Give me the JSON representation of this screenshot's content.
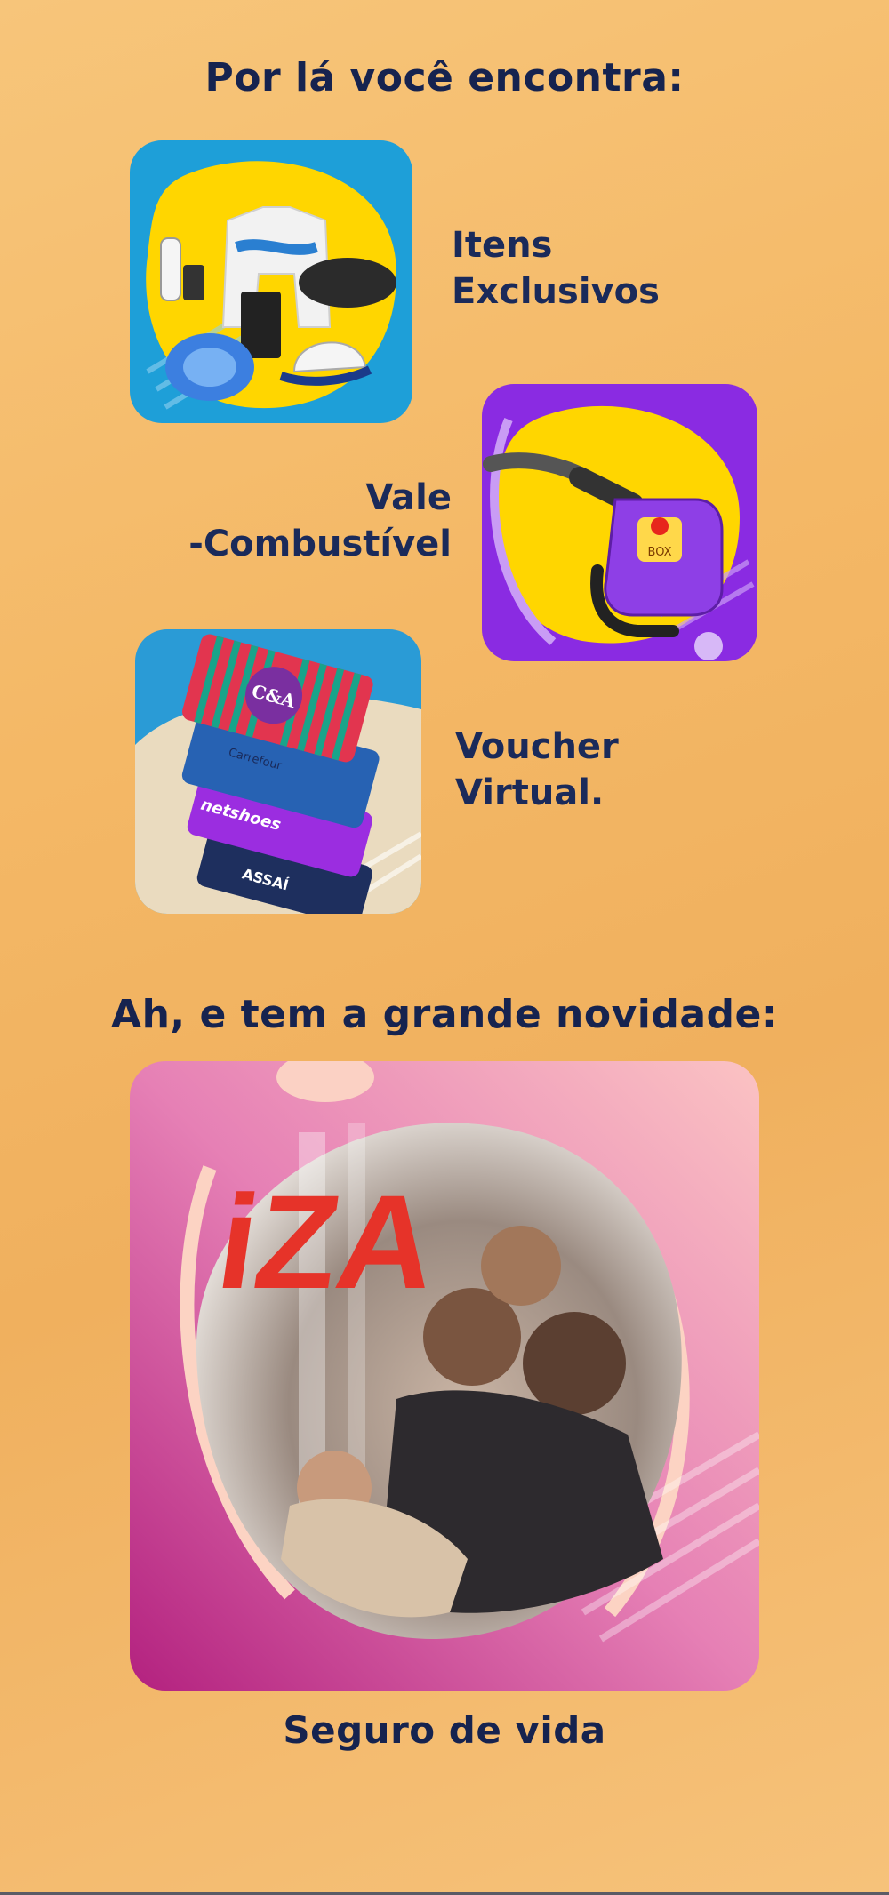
{
  "section_one": {
    "title": "Por lá você encontra:",
    "items": [
      {
        "label_line1": "Itens",
        "label_line2": "Exclusivos",
        "image": "exclusive-items-image"
      },
      {
        "label_line1": "Vale",
        "label_line2": "-Combustível",
        "image": "fuel-voucher-image"
      },
      {
        "label_line1": "Voucher",
        "label_line2": "Virtual.",
        "image": "virtual-voucher-image"
      }
    ]
  },
  "section_two": {
    "title": "Ah, e tem a grande novidade:",
    "brand": "iZA",
    "caption": "Seguro de vida"
  },
  "voucher_cards": {
    "cea": "C&A",
    "carrefour": "Carrefour",
    "netshoes": "netshoes",
    "assai": "ASSAÍ"
  },
  "pump_badge": "BOX",
  "colors": {
    "background": "#f4b866",
    "heading": "#16234f",
    "blue_card": "#1e9fd8",
    "purple_card": "#8a2be2",
    "yellow_blob": "#ffd600",
    "pink_card": "#e86aa6"
  }
}
